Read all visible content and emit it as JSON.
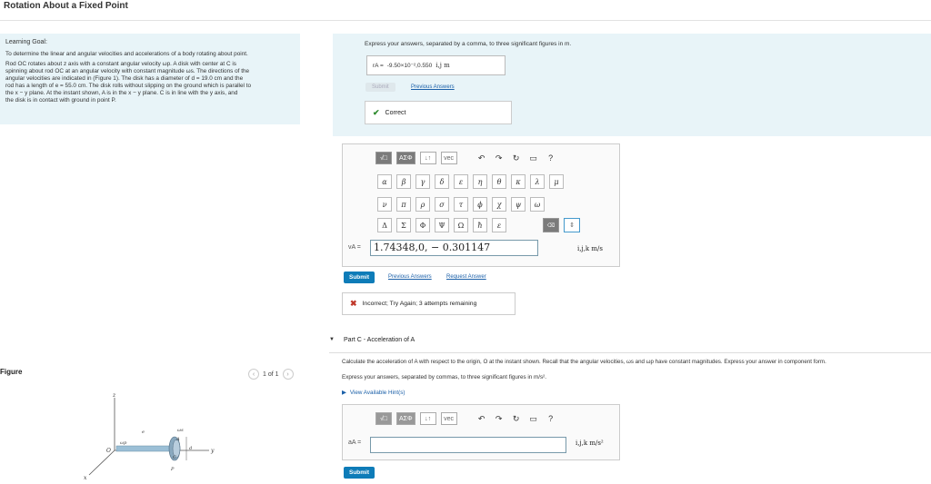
{
  "page": {
    "title": "Rotation About a Fixed Point"
  },
  "learning_goal": {
    "heading": "Learning Goal:",
    "goal": "To determine the linear and angular velocities and accelerations of a body rotating about point.",
    "description_lines": [
      "Rod OC rotates about z axis with a constant angular velocity ωp. A disk with center at C is",
      "spinning about rod OC at an angular velocity with constant magnitude ωs. The directions of the",
      "angular velocities are indicated in (Figure 1). The disk has a diameter of d = 19.0 cm and the",
      "rod has a length of e = 55.0 cm. The disk rolls without slipping on the ground which is parallel to",
      "the x − y plane. At the instant shown, A is in the x − y plane. C is in line with the y axis, and",
      "the disk is in contact with ground in point P."
    ]
  },
  "figure": {
    "label": "Figure",
    "pager": "1 of 1",
    "prev_icon": "chevron-left-icon",
    "next_icon": "chevron-right-icon",
    "labels": {
      "z": "z",
      "x": "x",
      "y": "y",
      "e": "e",
      "d": "d",
      "O": "O",
      "C": "C",
      "A": "A",
      "P": "P",
      "wp": "ωp",
      "ws": "ωs"
    }
  },
  "part_b_previous": {
    "instruction": "Express your answers, separated by a comma, to three significant figures in m.",
    "answer_label": "rA =",
    "answer_value": "-9.50×10⁻²,0.550",
    "answer_units": "i,j m",
    "submit_label": "Submit",
    "previous_answers": "Previous Answers",
    "correct_text": "Correct"
  },
  "editor_b": {
    "toolbar": [
      "√□",
      "ΑΣΦ",
      "↓↑",
      "vec"
    ],
    "tools": [
      "undo-icon",
      "redo-icon",
      "reset-icon",
      "keyboard-icon",
      "help-icon"
    ],
    "tool_glyphs": [
      "↶",
      "↷",
      "↻",
      "▭",
      "?"
    ],
    "greek_row1": [
      "α",
      "β",
      "γ",
      "δ",
      "ε",
      "η",
      "θ",
      "κ",
      "λ",
      "μ"
    ],
    "greek_row2": [
      "ν",
      "π",
      "ρ",
      "σ",
      "τ",
      "ϕ",
      "χ",
      "ψ",
      "ω"
    ],
    "greek_row3": [
      "Δ",
      "Σ",
      "Φ",
      "Ψ",
      "Ω",
      "ħ",
      "ε"
    ],
    "input_label": "vA =",
    "input_value": "1.74348,0, − 0.301147",
    "units": "i,j,k m/s",
    "submit_label": "Submit",
    "previous_answers": "Previous Answers",
    "request_answer": "Request Answer",
    "feedback": "Incorrect; Try Again; 3 attempts remaining"
  },
  "part_c": {
    "heading": "Part C - Acceleration of A",
    "question": "Calculate the acceleration of A with respect to the origin, O at the instant shown. Recall that the angular velocities, ωs and ωp have constant magnitudes. Express your answer in component form.",
    "instruction": "Express your answers, separated by commas, to three significant figures in m/s².",
    "hints": "View Available Hint(s)",
    "input_label": "aA =",
    "input_value": "",
    "units": "i,j,k m/s²",
    "submit_label": "Submit"
  },
  "colors": {
    "accent": "#0e7cb8",
    "panel": "#e8f4f8",
    "correct": "#2e8b2e",
    "incorrect": "#c0392b"
  }
}
